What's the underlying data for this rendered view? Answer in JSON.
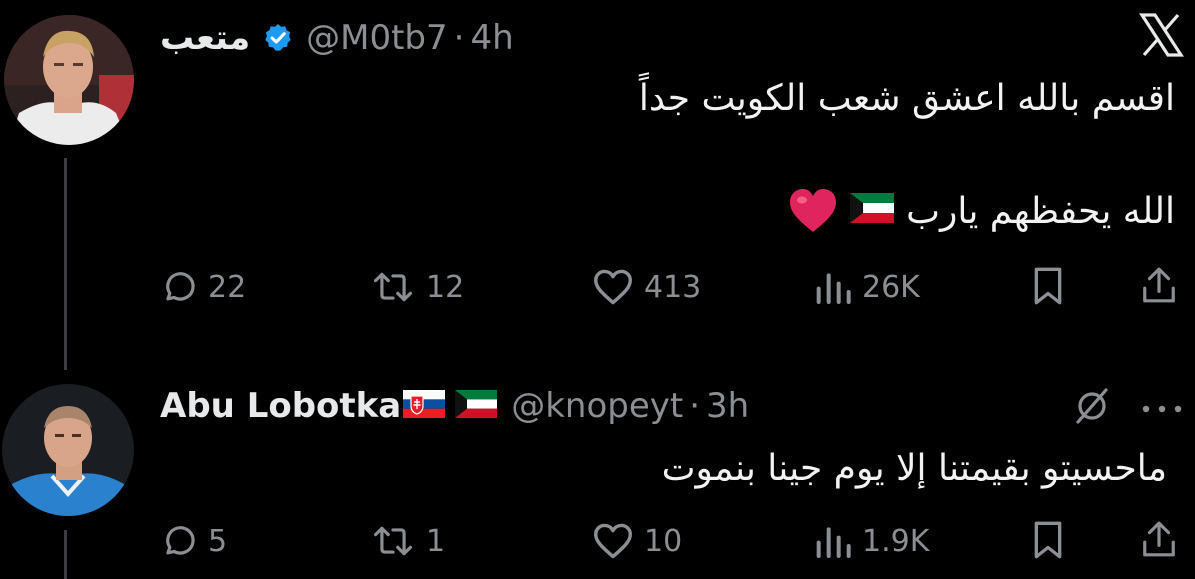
{
  "logo": "X",
  "tweets": [
    {
      "name": "متعب",
      "handle": "@M0tb7",
      "dot": "·",
      "time": "4h",
      "line1": "اقسم بالله اعشق شعب الكويت جداً",
      "line2": "الله يحفظهم يارب",
      "reply_count": "22",
      "retweet_count": "12",
      "like_count": "413",
      "view_count": "26K"
    },
    {
      "name": "Abu Lobotka",
      "handle": "@knopeyt",
      "dot": "·",
      "time": "3h",
      "line1": "ماحسيتو بقيمتنا إلا يوم جينا بنموت",
      "reply_count": "5",
      "retweet_count": "1",
      "like_count": "10",
      "view_count": "1.9K"
    }
  ],
  "colors": {
    "background": "#000000",
    "text": "#e7e9ea",
    "muted": "#8b8f94",
    "verified": "#1d9bf0",
    "heart": "#e0245e"
  }
}
